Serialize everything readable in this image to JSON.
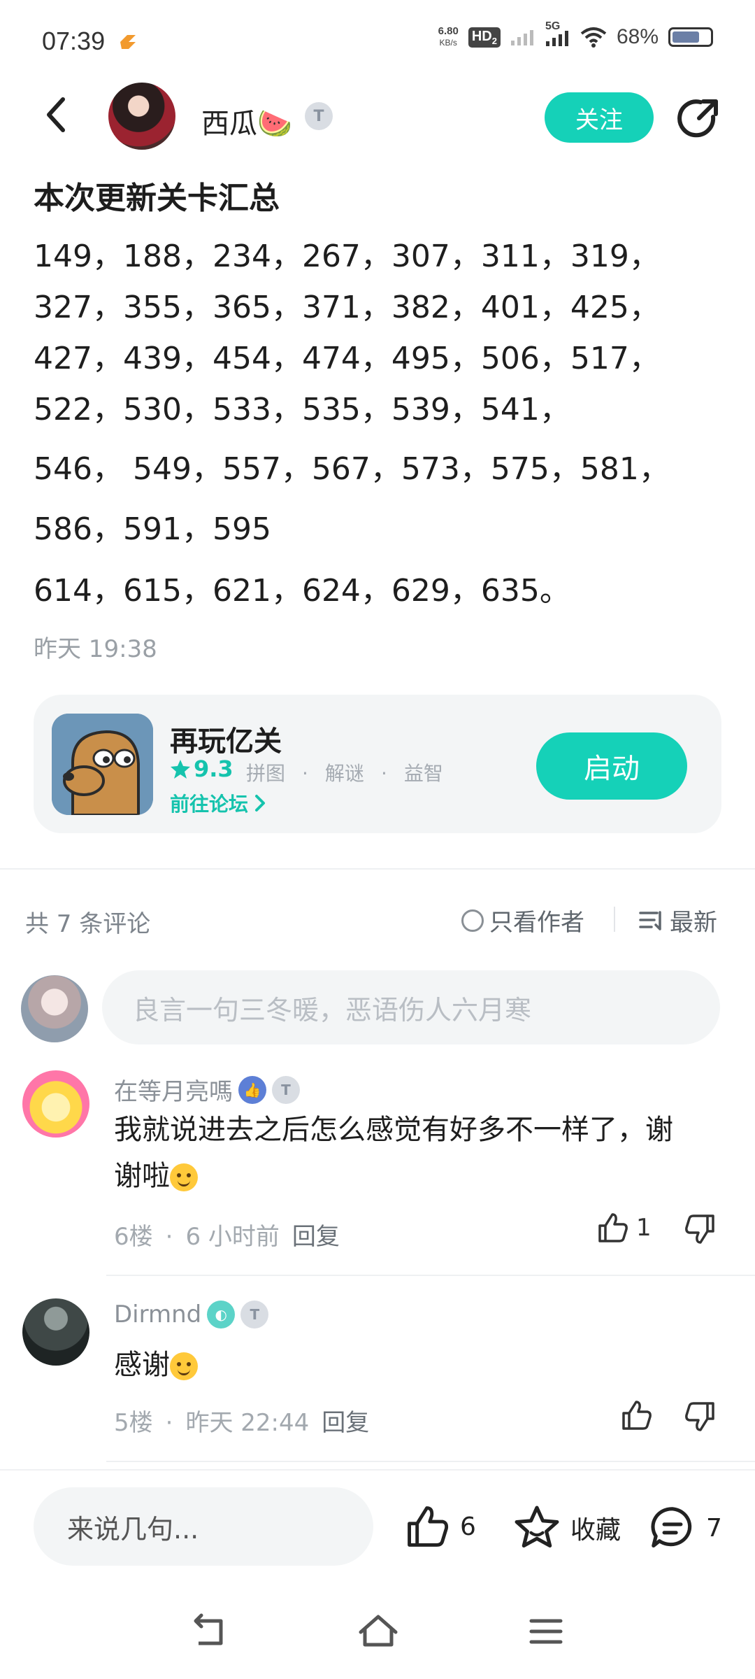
{
  "status_bar": {
    "time": "07:39",
    "net_speed_value": "6.80",
    "net_speed_unit": "KB/s",
    "hd_label": "HD",
    "hd_sub": "2",
    "signal_label": "5G",
    "battery_percent": "68%"
  },
  "header": {
    "author_name": "西瓜🍉",
    "level_badge": "T",
    "follow_label": "关注"
  },
  "post": {
    "title": "本次更新关卡汇总",
    "lines": [
      "149，188，234，267，307，311，319，",
      "327，355，365，371，382，401，425，",
      "427，439，454，474，495，506，517，",
      "522，530，533，535，539，541，",
      "546， 549，557，567，573，575，581，",
      "586，591，595",
      "614，615，621，624，629，635。"
    ],
    "time": "昨天 19:38"
  },
  "app_card": {
    "name": "再玩亿关",
    "rating": "9.3",
    "tags": [
      "拼图",
      "解谜",
      "益智"
    ],
    "tag_separator": "·",
    "forum_link": "前往论坛",
    "launch_label": "启动"
  },
  "comments_header": {
    "count_text": "共 7 条评论",
    "only_author": "只看作者",
    "sort_label": "最新"
  },
  "comment_input": {
    "placeholder": "良言一句三冬暖，恶语伤人六月寒"
  },
  "comments": [
    {
      "user": "在等月亮嗎",
      "badge": "T",
      "text_line1": "我就说进去之后怎么感觉有好多不一样了，谢",
      "text_line2": "谢啦",
      "floor": "6楼",
      "time": "6 小时前",
      "reply": "回复",
      "likes": "1"
    },
    {
      "user": "Dirmnd",
      "badge": "T",
      "text_line1": "感谢",
      "floor": "5楼",
      "time": "昨天 22:44",
      "reply": "回复",
      "likes": ""
    }
  ],
  "meta_separator": "·",
  "bottom_bar": {
    "input_placeholder": "来说几句...",
    "like_count": "6",
    "favorite_label": "收藏",
    "comment_count": "7"
  },
  "colors": {
    "accent": "#15d1b8",
    "text_muted": "#9aa0a6",
    "card_bg": "#f3f5f6"
  },
  "icons": [
    "back-icon",
    "share-icon",
    "star-icon",
    "chevron-right-icon",
    "circle-icon",
    "sort-icon",
    "thumb-up-icon",
    "thumb-down-icon",
    "favorite-star-icon",
    "comment-icon",
    "nav-back-icon",
    "nav-home-icon",
    "nav-menu-icon"
  ]
}
